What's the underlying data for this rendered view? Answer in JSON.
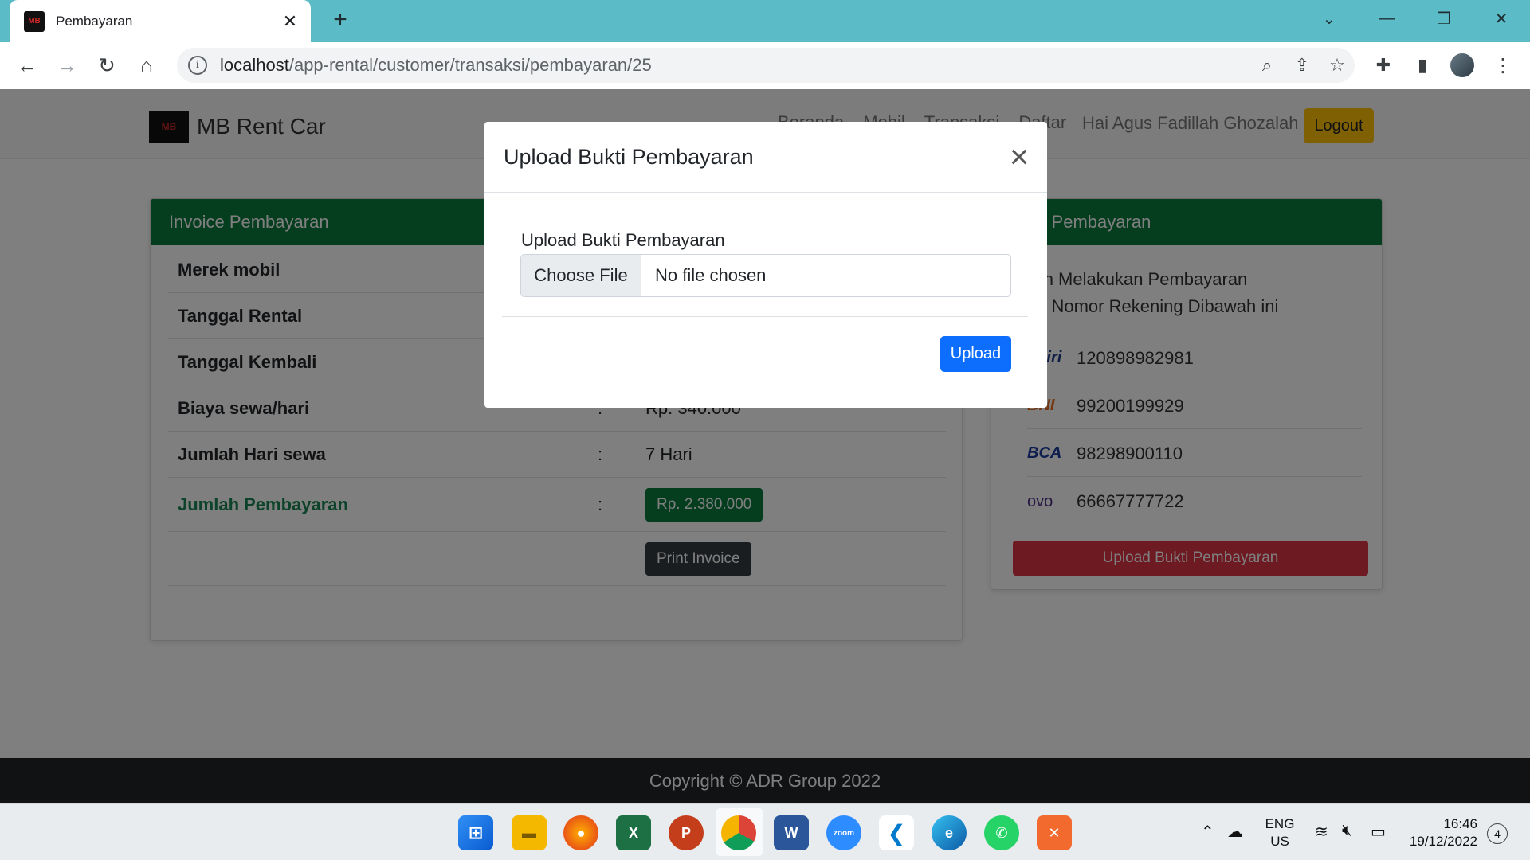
{
  "browser": {
    "tab_title": "Pembayaran",
    "tab_favicon": "MB",
    "url_host": "localhost",
    "url_path": "/app-rental/customer/transaksi/pembayaran/25"
  },
  "site": {
    "brand": "MB Rent Car",
    "logo_text": "MB",
    "nav": [
      "Beranda",
      "Mobil",
      "Transaksi",
      "Daftar"
    ],
    "greeting": "Hai Agus Fadillah Ghozalah",
    "logout": "Logout"
  },
  "invoice": {
    "header": "Invoice Pembayaran",
    "rows": [
      {
        "label": "Merek mobil",
        "sep": "",
        "value": ""
      },
      {
        "label": "Tanggal Rental",
        "sep": "",
        "value": ""
      },
      {
        "label": "Tanggal Kembali",
        "sep": "",
        "value": ""
      },
      {
        "label": "Biaya sewa/hari",
        "sep": ":",
        "value": "Rp. 340.000"
      },
      {
        "label": "Jumlah Hari sewa",
        "sep": ":",
        "value": "7 Hari"
      },
      {
        "label": "Jumlah Pembayaran",
        "sep": ":",
        "value": "Rp. 2.380.000"
      }
    ],
    "print_button": "Print Invoice"
  },
  "payment_info": {
    "header": "masi Pembayaran",
    "text_line1": "ahkan Melakukan Pembayaran",
    "text_line2": "elalui Nomor Rekening Dibawah ini",
    "banks": [
      {
        "logo": "ndiri",
        "number": "120898982981",
        "color": "#1f3d8a"
      },
      {
        "logo": "BNI",
        "number": "99200199929",
        "color": "#e86b1f"
      },
      {
        "logo": "BCA",
        "number": "98298900110",
        "color": "#1a3d9c"
      },
      {
        "logo": "ovo",
        "number": "66667777722",
        "color": "#4c2a86"
      }
    ],
    "upload_button": "Upload Bukti Pembayaran"
  },
  "footer": {
    "text": "Copyright © ADR Group 2022"
  },
  "modal": {
    "title": "Upload Bukti Pembayaran",
    "close": "×",
    "label": "Upload Bukti Pembayaran",
    "file_button": "Choose File",
    "file_status": "No file chosen",
    "submit": "Upload"
  },
  "taskbar": {
    "lang": "ENG",
    "region": "US",
    "time": "16:46",
    "date": "19/12/2022",
    "notifications": "4"
  },
  "colors": {
    "tabstrip": "#5bbcc7",
    "invoice_header": "#0b7a3e",
    "logout": "#ffc107",
    "upload_main": "#dc3545",
    "upload_modal": "#0d6efd"
  }
}
